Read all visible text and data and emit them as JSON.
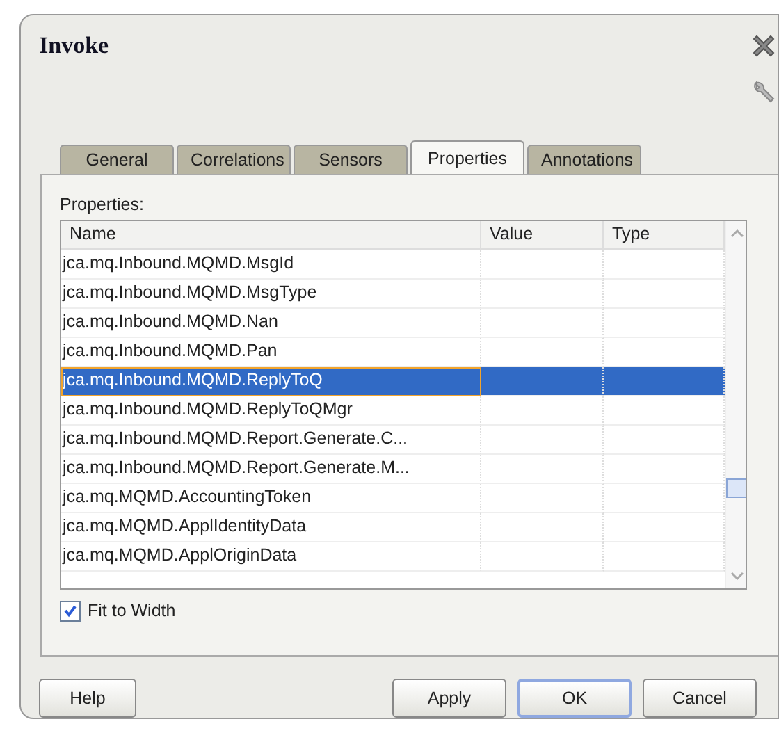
{
  "window": {
    "title": "Invoke"
  },
  "tabs": [
    {
      "label": "General",
      "selected": false
    },
    {
      "label": "Correlations",
      "selected": false
    },
    {
      "label": "Sensors",
      "selected": false
    },
    {
      "label": "Properties",
      "selected": true
    },
    {
      "label": "Annotations",
      "selected": false
    }
  ],
  "properties_label": "Properties:",
  "table": {
    "columns": [
      "Name",
      "Value",
      "Type"
    ],
    "rows": [
      {
        "name": "jca.mq.Inbound.MQMD.MsgId",
        "selected": false
      },
      {
        "name": "jca.mq.Inbound.MQMD.MsgType",
        "selected": false
      },
      {
        "name": "jca.mq.Inbound.MQMD.Nan",
        "selected": false
      },
      {
        "name": "jca.mq.Inbound.MQMD.Pan",
        "selected": false
      },
      {
        "name": "jca.mq.Inbound.MQMD.ReplyToQ",
        "selected": true
      },
      {
        "name": "jca.mq.Inbound.MQMD.ReplyToQMgr",
        "selected": false
      },
      {
        "name": "jca.mq.Inbound.MQMD.Report.Generate.C...",
        "selected": false
      },
      {
        "name": "jca.mq.Inbound.MQMD.Report.Generate.M...",
        "selected": false
      },
      {
        "name": "jca.mq.MQMD.AccountingToken",
        "selected": false
      },
      {
        "name": "jca.mq.MQMD.ApplIdentityData",
        "selected": false
      },
      {
        "name": "jca.mq.MQMD.ApplOriginData",
        "selected": false
      }
    ]
  },
  "fit_to_width": {
    "label": "Fit to Width",
    "checked": true
  },
  "buttons": [
    {
      "label": "Help",
      "kind": "help"
    },
    {
      "label": "Apply",
      "kind": "normal"
    },
    {
      "label": "OK",
      "kind": "default"
    },
    {
      "label": "Cancel",
      "kind": "normal"
    }
  ]
}
